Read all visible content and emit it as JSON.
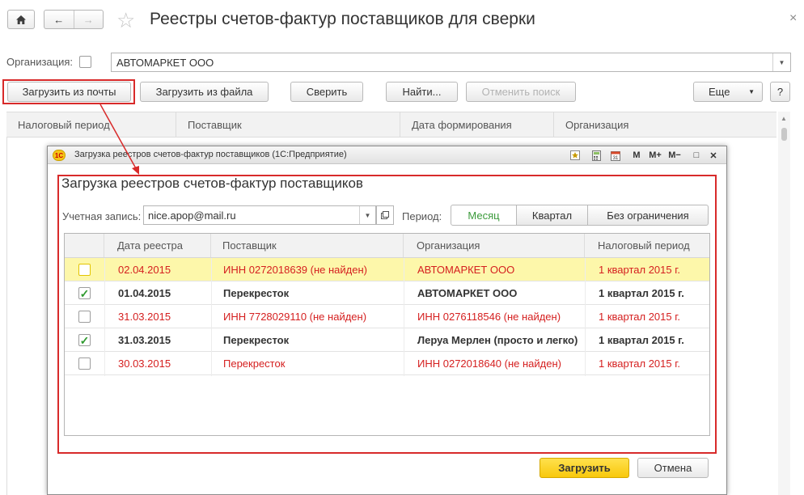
{
  "window": {
    "title": "Реестры счетов-фактур поставщиков для сверки",
    "close_glyph": "×"
  },
  "nav": {
    "home_icon": "home-icon",
    "back_icon": "←",
    "forward_icon": "→",
    "favorite_icon": "☆"
  },
  "org": {
    "label": "Организация:",
    "value": "АВТОМАРКЕТ ООО"
  },
  "toolbar": {
    "load_mail": "Загрузить из почты",
    "load_file": "Загрузить из файла",
    "compare": "Сверить",
    "find": "Найти...",
    "cancel_search": "Отменить поиск",
    "more": "Еще",
    "help": "?"
  },
  "main_table": {
    "columns": [
      "Налоговый период",
      "Поставщик",
      "Дата формирования",
      "Организация"
    ]
  },
  "dialog": {
    "title": "Загрузка реестров счетов-фактур поставщиков  (1С:Предприятие)",
    "heading": "Загрузка реестров счетов-фактур поставщиков",
    "account_label": "Учетная запись:",
    "account_value": "nice.apop@mail.ru",
    "period_label": "Период:",
    "period_options": [
      "Месяц",
      "Квартал",
      "Без ограничения"
    ],
    "period_selected": "Месяц",
    "ctrl": {
      "m": "M",
      "mplus": "M+",
      "mminus": "M−",
      "max": "□",
      "close": "✕"
    },
    "columns": [
      "Дата реестра",
      "Поставщик",
      "Организация",
      "Налоговый период"
    ],
    "rows": [
      {
        "checked": false,
        "style": "red",
        "selected": true,
        "date": "02.04.2015",
        "supplier": "ИНН 0272018639 (не найден)",
        "org": "АВТОМАРКЕТ ООО",
        "period": "1 квартал 2015 г."
      },
      {
        "checked": true,
        "style": "bold",
        "selected": false,
        "date": "01.04.2015",
        "supplier": "Перекресток",
        "org": "АВТОМАРКЕТ ООО",
        "period": "1 квартал 2015 г."
      },
      {
        "checked": false,
        "style": "red",
        "selected": false,
        "date": "31.03.2015",
        "supplier": "ИНН 7728029110 (не найден)",
        "org": "ИНН 0276118546 (не найден)",
        "period": "1 квартал 2015 г."
      },
      {
        "checked": true,
        "style": "bold",
        "selected": false,
        "date": "31.03.2015",
        "supplier": "Перекресток",
        "org": "Леруа Мерлен (просто и легко)",
        "period": "1 квартал 2015 г."
      },
      {
        "checked": false,
        "style": "red",
        "selected": false,
        "date": "30.03.2015",
        "supplier": "Перекресток",
        "org": "ИНН 0272018640 (не найден)",
        "period": "1 квартал 2015 г."
      }
    ],
    "load_button": "Загрузить",
    "cancel_button": "Отмена"
  },
  "colors": {
    "highlight_red": "#d82a2a",
    "error_text": "#d52020",
    "selected_row": "#fdf7aa",
    "primary_button": "#f8c80c",
    "active_segment_text": "#3a9a3a"
  }
}
